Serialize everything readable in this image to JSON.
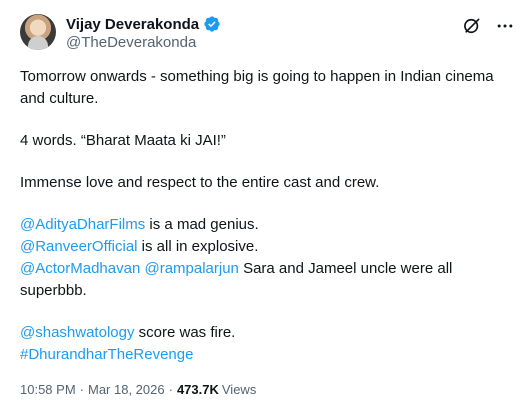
{
  "author": {
    "name": "Vijay Deverakonda",
    "handle": "@TheDeverakonda",
    "verified_color": "#1d9bf0"
  },
  "tweet": {
    "line1": "Tomorrow onwards - something big is going to happen in Indian cinema and culture.",
    "line2": "4 words. “Bharat Maata ki JAI!”",
    "line3": "Immense love and respect to the entire cast and crew.",
    "m1": "@AdityaDharFilms",
    "m1_text": " is a mad genius.",
    "m2": "@RanveerOfficial",
    "m2_text": " is all in explosive.",
    "m3": "@ActorMadhavan",
    "m3_space": " ",
    "m4": "@rampalarjun",
    "m4_text": " Sara and Jameel uncle were all superbbb.",
    "m5": "@shashwatology",
    "m5_text": " score was fire.",
    "hashtag": "#DhurandharTheRevenge"
  },
  "meta": {
    "time": "10:58 PM",
    "sep": "·",
    "date": "Mar 18, 2026",
    "views_count": "473.7K",
    "views_label": "Views"
  },
  "icons": {
    "grok": "grok-icon",
    "more": "more-icon",
    "verified": "verified-badge-icon"
  },
  "colors": {
    "link": "#1d9bf0",
    "text": "#0f1419",
    "secondary": "#536471"
  }
}
